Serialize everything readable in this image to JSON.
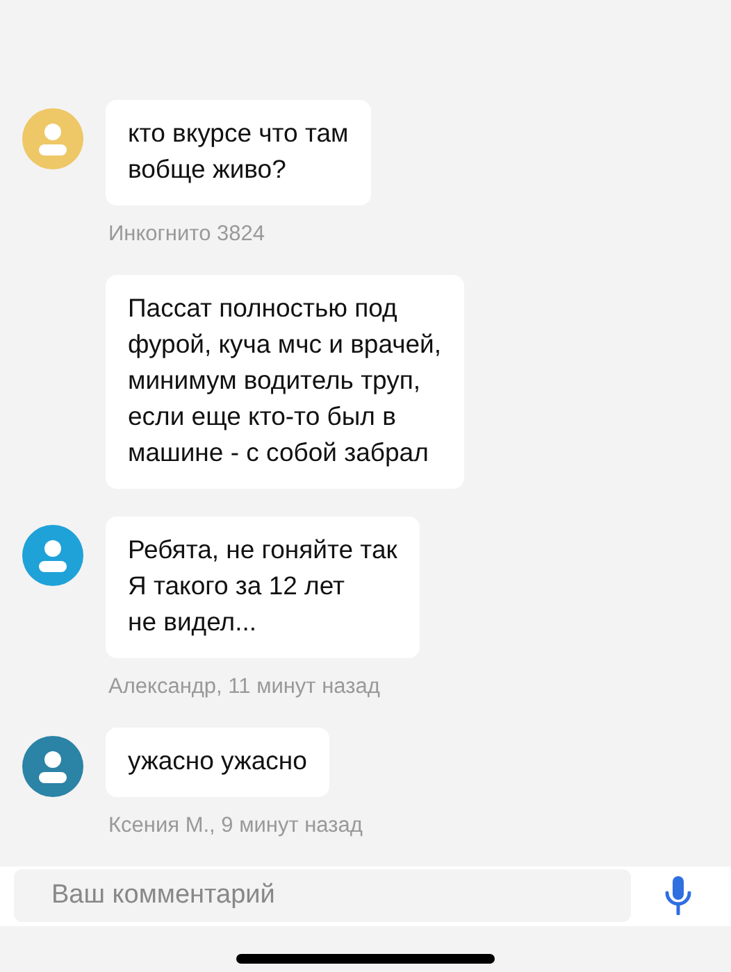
{
  "messages": [
    {
      "avatar": {
        "color": "#eec766"
      },
      "text": "кто вкурсе что там\nвобще живо?",
      "meta": "Инкогнито 3824"
    },
    {
      "text": "Пассат полностью под\nфурой, куча мчс и врачей,\nминимум водитель труп,\nесли еще кто-то был в\nмашине - с собой забрал"
    },
    {
      "avatar": {
        "color": "#1ea2d8"
      },
      "text": "Ребята, не гоняйте так\nЯ такого за 12 лет\nне видел...",
      "meta": "Александр, 11 минут назад"
    },
    {
      "avatar": {
        "color": "#2b83a6"
      },
      "text": "ужасно ужасно",
      "meta": "Ксения М., 9 минут назад"
    }
  ],
  "composer": {
    "placeholder": "Ваш комментарий"
  }
}
